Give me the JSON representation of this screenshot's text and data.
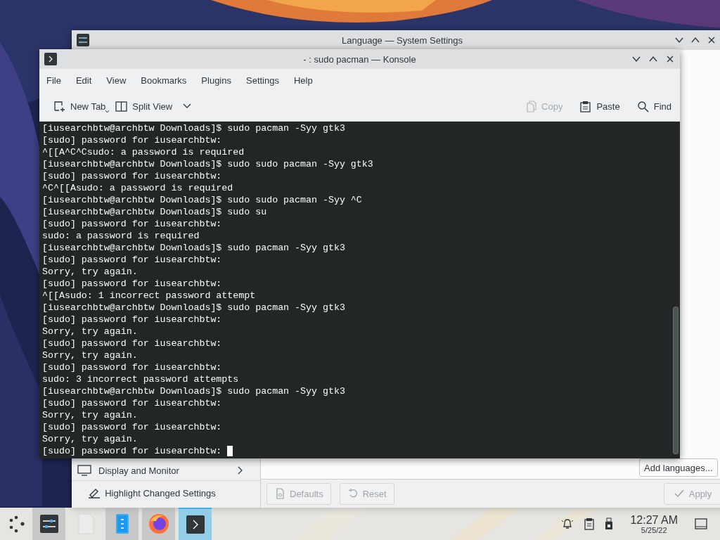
{
  "settings_window": {
    "title": "Language — System Settings",
    "sidebar_items": [
      {
        "label": "Display and Monitor"
      }
    ],
    "highlight_button": "Highlight Changed Settings",
    "add_button": "Add languages...",
    "footer_buttons": [
      {
        "label": "Defaults",
        "kind": "defaults",
        "disabled": true
      },
      {
        "label": "Reset",
        "kind": "reset",
        "disabled": true
      },
      {
        "label": "Apply",
        "kind": "apply",
        "disabled": true
      }
    ]
  },
  "konsole": {
    "title": "- : sudo pacman — Konsole",
    "menu": [
      "File",
      "Edit",
      "View",
      "Bookmarks",
      "Plugins",
      "Settings",
      "Help"
    ],
    "toolbar_left": [
      {
        "label": "New Tab",
        "kind": "newtab",
        "disabled": false
      },
      {
        "label": "Split View",
        "kind": "split",
        "disabled": false
      }
    ],
    "toolbar_right": [
      {
        "label": "Copy",
        "kind": "copy",
        "disabled": true
      },
      {
        "label": "Paste",
        "kind": "paste",
        "disabled": false
      },
      {
        "label": "Find",
        "kind": "find",
        "disabled": false
      }
    ],
    "lines": [
      "[iusearchbtw@archbtw Downloads]$ sudo pacman -Syy gtk3",
      "[sudo] password for iusearchbtw:",
      "^[[A^C^Csudo: a password is required",
      "[iusearchbtw@archbtw Downloads]$ sudo sudo pacman -Syy gtk3",
      "[sudo] password for iusearchbtw:",
      "^C^[[Asudo: a password is required",
      "[iusearchbtw@archbtw Downloads]$ sudo sudo pacman -Syy ^C",
      "[iusearchbtw@archbtw Downloads]$ sudo su",
      "[sudo] password for iusearchbtw:",
      "sudo: a password is required",
      "[iusearchbtw@archbtw Downloads]$ sudo pacman -Syy gtk3",
      "[sudo] password for iusearchbtw:",
      "Sorry, try again.",
      "[sudo] password for iusearchbtw:",
      "^[[Asudo: 1 incorrect password attempt",
      "[iusearchbtw@archbtw Downloads]$ sudo pacman -Syy gtk3",
      "[sudo] password for iusearchbtw:",
      "Sorry, try again.",
      "[sudo] password for iusearchbtw:",
      "Sorry, try again.",
      "[sudo] password for iusearchbtw:",
      "sudo: 3 incorrect password attempts",
      "[iusearchbtw@archbtw Downloads]$ sudo pacman -Syy gtk3",
      "[sudo] password for iusearchbtw:",
      "Sorry, try again.",
      "[sudo] password for iusearchbtw:",
      "Sorry, try again.",
      "[sudo] password for iusearchbtw: "
    ]
  },
  "taskbar": {
    "tasks": [
      {
        "kind": "settings",
        "running": true,
        "active": false
      },
      {
        "kind": "document",
        "running": false,
        "active": false
      },
      {
        "kind": "filemanager",
        "running": true,
        "active": false
      },
      {
        "kind": "browser",
        "running": true,
        "active": false
      },
      {
        "kind": "terminal",
        "running": true,
        "active": true
      }
    ],
    "clock": {
      "time": "12:27 AM",
      "date": "5/25/22"
    }
  }
}
